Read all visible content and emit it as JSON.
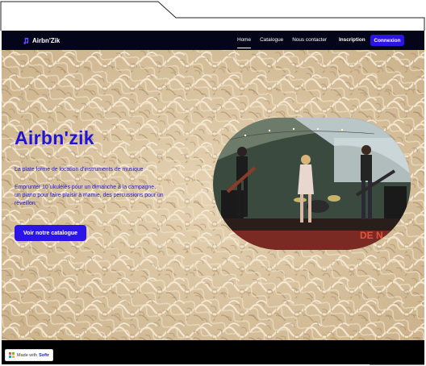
{
  "nav": {
    "brand": "Airbn'Zik",
    "links": [
      "Home",
      "Catalogue",
      "Nous contacter"
    ],
    "signup": "Inscription",
    "login": "Connexion"
  },
  "hero": {
    "title": "Airbn'zik",
    "tagline": "La plate forme de location d'instruments de musique",
    "description_line1": "Emprunter 10 ukulélés pour un dimanche à la campagne,",
    "description_line2": "un piano pour faire plaisir à mamie, des percussions pour un",
    "description_line3": "réveillon",
    "cta": "Voir notre catalogue"
  },
  "badge": {
    "made_with": "Made with",
    "brand": "Softr"
  },
  "colors": {
    "accent": "#2b14e8",
    "text_accent": "#2214d6",
    "nav_bg": "#05051a"
  }
}
